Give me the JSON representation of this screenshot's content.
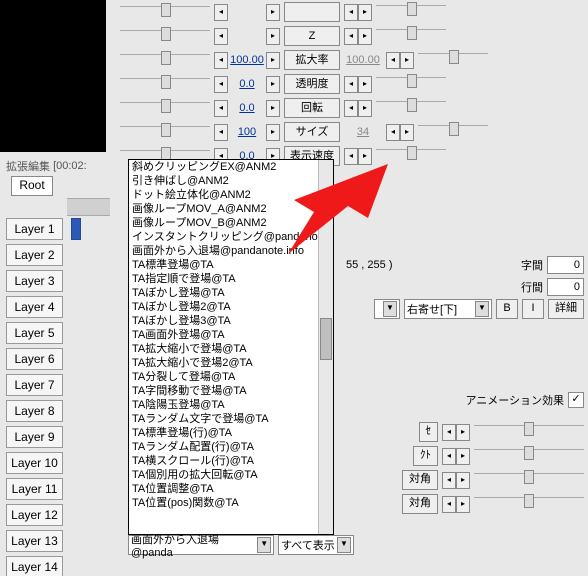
{
  "preview": true,
  "timeline": {
    "title_prefix": "拡張編集",
    "timecode": "[00:02:",
    "root_button": "Root",
    "layers": [
      "Layer 1",
      "Layer 2",
      "Layer 3",
      "Layer 4",
      "Layer 5",
      "Layer 6",
      "Layer 7",
      "Layer 8",
      "Layer 9",
      "Layer 10",
      "Layer 11",
      "Layer 12",
      "Layer 13",
      "Layer 14"
    ]
  },
  "params": [
    {
      "val": "",
      "name": "",
      "blank": true
    },
    {
      "val": "",
      "name": "Z"
    },
    {
      "val": "100.00",
      "name": "拡大率",
      "val2": "100.00"
    },
    {
      "val": "0.0",
      "name": "透明度"
    },
    {
      "val": "0.0",
      "name": "回転"
    },
    {
      "val": "100",
      "name": "サイズ",
      "val2": "34"
    },
    {
      "val": "0.0",
      "name": "表示速度"
    }
  ],
  "dropdown": {
    "items": [
      "斜めクリッピングEX@ANM2",
      "引き伸ばし@ANM2",
      "ドット絵立体化@ANM2",
      "画像ループMOV_A@ANM2",
      "画像ループMOV_B@ANM2",
      "インスタントクリッピング@pandanot",
      "画面外から入退場@pandanote.info",
      "TA標準登場@TA",
      "TA指定順で登場@TA",
      "TAぼかし登場@TA",
      "TAぼかし登場2@TA",
      "TAぼかし登場3@TA",
      "TA画面外登場@TA",
      "TA拡大縮小で登場@TA",
      "TA拡大縮小で登場2@TA",
      "TA分裂して登場@TA",
      "TA字間移動で登場@TA",
      "TA陰陽玉登場@TA",
      "TAランダム文字で登場@TA",
      "TA標準登場(行)@TA",
      "TAランダム配置(行)@TA",
      "TA横スクロール(行)@TA",
      "TA個別用の拡大回転@TA",
      "TA位置調整@TA",
      "TA位置(pos)関数@TA"
    ],
    "selected": "画面外から入退場@panda",
    "filter": "すべて表示"
  },
  "detail": {
    "coords_note": "55 , 255 )",
    "char_spacing_label": "字間",
    "char_spacing": "0",
    "line_spacing_label": "行間",
    "line_spacing": "0",
    "align": "右寄せ[下]",
    "B": "B",
    "I": "I",
    "detail_btn": "詳細",
    "anim_effect_label": "アニメーション効果",
    "anim_checked": "✓",
    "eff_btn_set": "ｾ",
    "eff_btn_list": "ｸﾄ",
    "eff_corner1": "対角",
    "eff_corner2": "対角"
  }
}
